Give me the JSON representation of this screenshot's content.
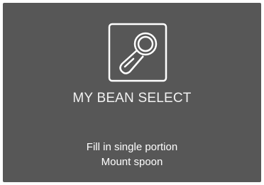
{
  "screen": {
    "icon": "spoon-icon",
    "title": "MY BEAN SELECT",
    "instructions": [
      "Fill in single portion",
      "Mount spoon"
    ],
    "colors": {
      "background": "#575757",
      "foreground": "#ffffff"
    }
  }
}
